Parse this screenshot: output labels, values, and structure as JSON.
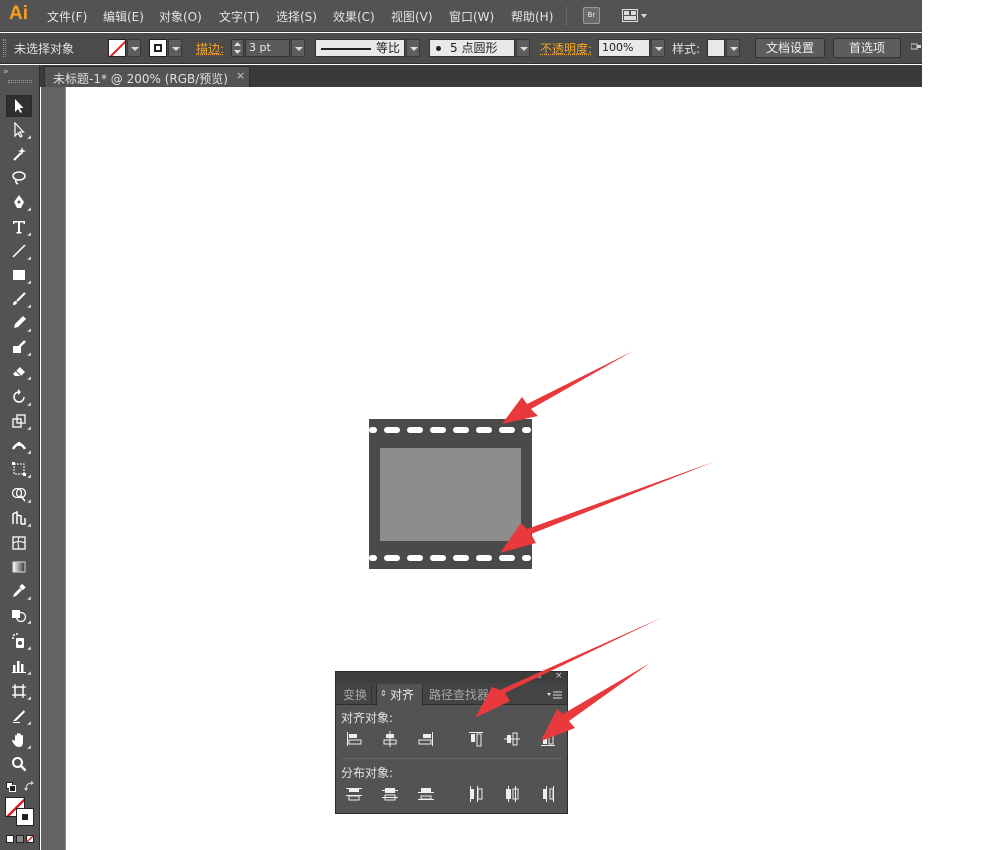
{
  "app": {
    "logo": "Ai"
  },
  "menu": {
    "items": [
      "文件(F)",
      "编辑(E)",
      "对象(O)",
      "文字(T)",
      "选择(S)",
      "效果(C)",
      "视图(V)",
      "窗口(W)",
      "帮助(H)"
    ],
    "bridge_label": "Br"
  },
  "control_bar": {
    "selection_status": "未选择对象",
    "stroke_label": "描边:",
    "stroke_weight": "3 pt",
    "stroke_profile": "等比",
    "brush": "5 点圆形",
    "opacity_label": "不透明度:",
    "opacity_value": "100%",
    "style_label": "样式:",
    "doc_setup_button": "文档设置",
    "preferences_button": "首选项"
  },
  "document_tab": {
    "title": "未标题-1* @ 200% (RGB/预览)",
    "close": "×"
  },
  "align_panel": {
    "tabs": [
      "变换",
      "对齐",
      "路径查找器"
    ],
    "active_tab": "对齐",
    "align_objects_title": "对齐对象:",
    "distribute_objects_title": "分布对象:",
    "align_objects_icons": [
      "align-left-icon",
      "align-horizontal-center-icon",
      "align-right-icon",
      "align-top-icon",
      "align-vertical-center-icon",
      "align-bottom-icon"
    ],
    "distribute_objects_icons": [
      "distribute-top-icon",
      "distribute-vertical-center-icon",
      "distribute-bottom-icon",
      "distribute-left-icon",
      "distribute-horizontal-center-icon",
      "distribute-right-icon"
    ]
  },
  "colors": {
    "accent_orange": "#f5a623",
    "annotation_arrow": "#e8393d",
    "film_frame": "#4b4a4b",
    "film_screen": "#8e8c8d"
  }
}
